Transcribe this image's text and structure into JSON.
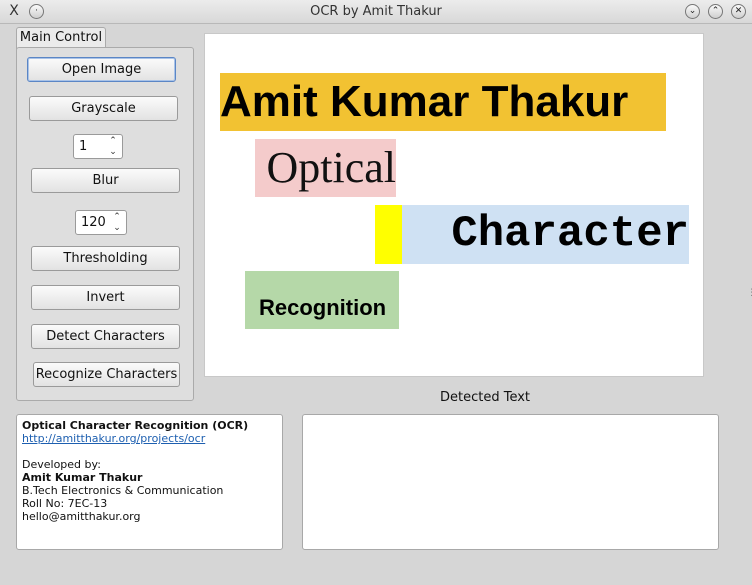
{
  "window": {
    "title": "OCR by Amit Thakur",
    "app_icon": "X",
    "menu_dot": "·",
    "btn_min": "⌄",
    "btn_max": "⌃",
    "btn_close": "✕"
  },
  "tab": {
    "label": "Main Control"
  },
  "controls": {
    "open_image": "Open Image",
    "grayscale": "Grayscale",
    "blur_value": "1",
    "blur": "Blur",
    "threshold_value": "120",
    "thresholding": "Thresholding",
    "invert": "Invert",
    "detect": "Detect Characters",
    "recognize": "Recognize Characters",
    "spin_up": "⌃",
    "spin_down": "⌄"
  },
  "image": {
    "word1": "Amit Kumar Thakur",
    "word2": "Optical",
    "word3": "Character",
    "word4": "Recognition"
  },
  "detected_label": "Detected Text",
  "info": {
    "title": "Optical Character Recognition (OCR)",
    "link": "http://amitthakur.org/projects/ocr",
    "dev_label": "Developed by:",
    "name": "Amit Kumar Thakur",
    "degree": "B.Tech Electronics & Communication",
    "roll": "Roll No: 7EC-13",
    "email": "hello@amitthakur.org"
  },
  "colors": {
    "highlight_orange": "#f2c232",
    "highlight_pink": "#f4cbcb",
    "highlight_yellow": "#ffff00",
    "highlight_blue": "#cfe1f3",
    "highlight_green": "#b5d8a8",
    "link": "#1d5fb0"
  }
}
